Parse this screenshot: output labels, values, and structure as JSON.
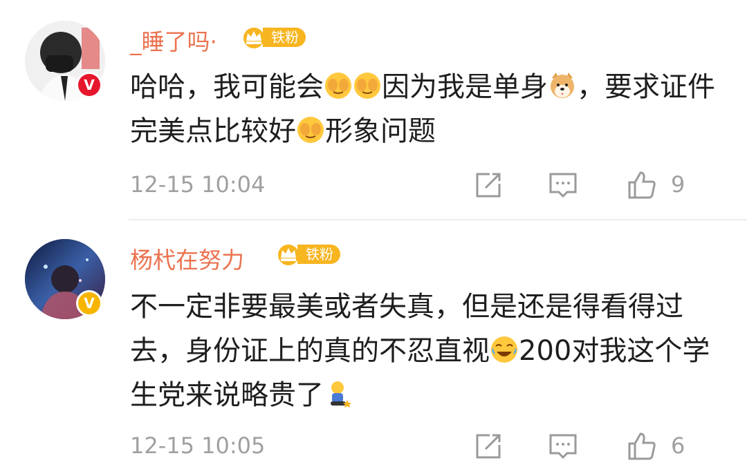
{
  "comments": [
    {
      "username": "_睡了吗·",
      "fan_badge": "铁粉",
      "verified_color": "#e6162d",
      "text_parts": [
        "哈哈，我可能会",
        "因为我是单身",
        "，要求证件完美点比较好",
        "形象问题"
      ],
      "emojis": [
        "covering-face-emoji",
        "covering-face-emoji",
        "doge-emoji",
        "covering-face-emoji"
      ],
      "time": "12-15 10:04",
      "likes": "9"
    },
    {
      "username": "杨杙在努力",
      "fan_badge": "铁粉",
      "verified_color": "#f7b500",
      "text_parts": [
        "不一定非要最美或者失真，但是还是得看得过去，身份证上的真的不忍直视",
        "200对我这个学生党来说略贵了"
      ],
      "emojis": [
        "crying-laugh-emoji",
        "kneeling-emoji"
      ],
      "time": "12-15 10:05",
      "likes": "6"
    }
  ],
  "colors": {
    "username": "#eb7350",
    "badge": "#f7b520",
    "meta": "#a0a0a0"
  }
}
